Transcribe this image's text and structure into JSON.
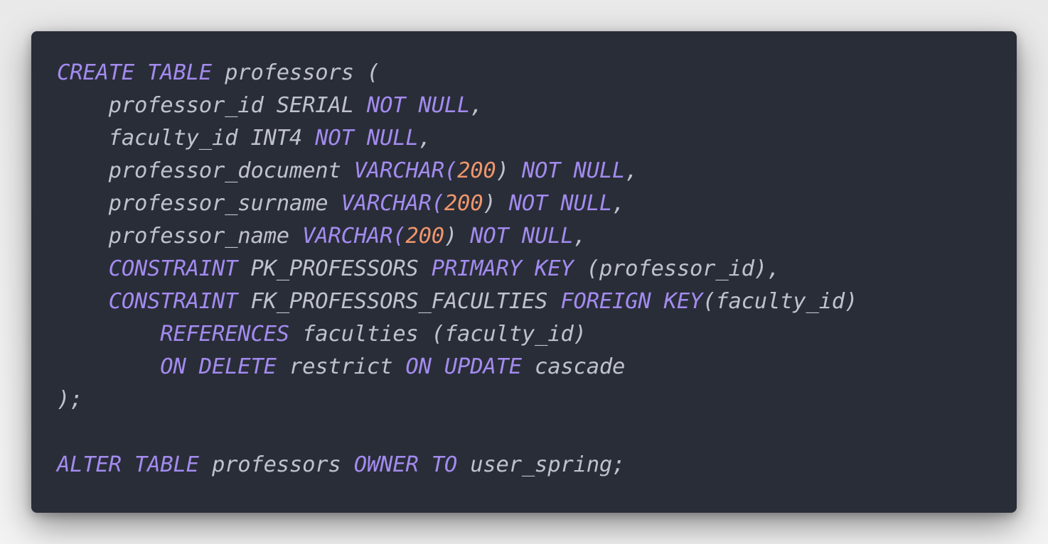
{
  "colors": {
    "background": "#292d38",
    "keyword": "#a38bef",
    "number": "#f0966c",
    "identifier": "#bfc2cc"
  },
  "code": {
    "language": "SQL",
    "lines": [
      [
        {
          "t": "kw",
          "v": "CREATE TABLE"
        },
        {
          "t": "id",
          "v": " professors ("
        }
      ],
      [
        {
          "t": "id",
          "v": "    professor_id SERIAL "
        },
        {
          "t": "kw",
          "v": "NOT NULL"
        },
        {
          "t": "pn",
          "v": ","
        }
      ],
      [
        {
          "t": "id",
          "v": "    faculty_id INT4 "
        },
        {
          "t": "kw",
          "v": "NOT NULL"
        },
        {
          "t": "pn",
          "v": ","
        }
      ],
      [
        {
          "t": "id",
          "v": "    professor_document "
        },
        {
          "t": "kw",
          "v": "VARCHAR("
        },
        {
          "t": "num",
          "v": "200"
        },
        {
          "t": "pn",
          "v": ") "
        },
        {
          "t": "kw",
          "v": "NOT NULL"
        },
        {
          "t": "pn",
          "v": ","
        }
      ],
      [
        {
          "t": "id",
          "v": "    professor_surname "
        },
        {
          "t": "kw",
          "v": "VARCHAR("
        },
        {
          "t": "num",
          "v": "200"
        },
        {
          "t": "pn",
          "v": ") "
        },
        {
          "t": "kw",
          "v": "NOT NULL"
        },
        {
          "t": "pn",
          "v": ","
        }
      ],
      [
        {
          "t": "id",
          "v": "    professor_name "
        },
        {
          "t": "kw",
          "v": "VARCHAR("
        },
        {
          "t": "num",
          "v": "200"
        },
        {
          "t": "pn",
          "v": ") "
        },
        {
          "t": "kw",
          "v": "NOT NULL"
        },
        {
          "t": "pn",
          "v": ","
        }
      ],
      [
        {
          "t": "kw",
          "v": "    CONSTRAINT"
        },
        {
          "t": "id",
          "v": " PK_PROFESSORS "
        },
        {
          "t": "kw",
          "v": "PRIMARY KEY"
        },
        {
          "t": "id",
          "v": " (professor_id),"
        }
      ],
      [
        {
          "t": "kw",
          "v": "    CONSTRAINT"
        },
        {
          "t": "id",
          "v": " FK_PROFESSORS_FACULTIES "
        },
        {
          "t": "kw",
          "v": "FOREIGN KEY"
        },
        {
          "t": "id",
          "v": "(faculty_id)"
        }
      ],
      [
        {
          "t": "kw",
          "v": "        REFERENCES"
        },
        {
          "t": "id",
          "v": " faculties (faculty_id)"
        }
      ],
      [
        {
          "t": "kw",
          "v": "        ON DELETE"
        },
        {
          "t": "id",
          "v": " restrict "
        },
        {
          "t": "kw",
          "v": "ON UPDATE"
        },
        {
          "t": "id",
          "v": " cascade"
        }
      ],
      [
        {
          "t": "pn",
          "v": ");"
        }
      ],
      [],
      [
        {
          "t": "kw",
          "v": "ALTER TABLE"
        },
        {
          "t": "id",
          "v": " professors "
        },
        {
          "t": "kw",
          "v": "OWNER TO"
        },
        {
          "t": "id",
          "v": " user_spring;"
        }
      ]
    ]
  }
}
